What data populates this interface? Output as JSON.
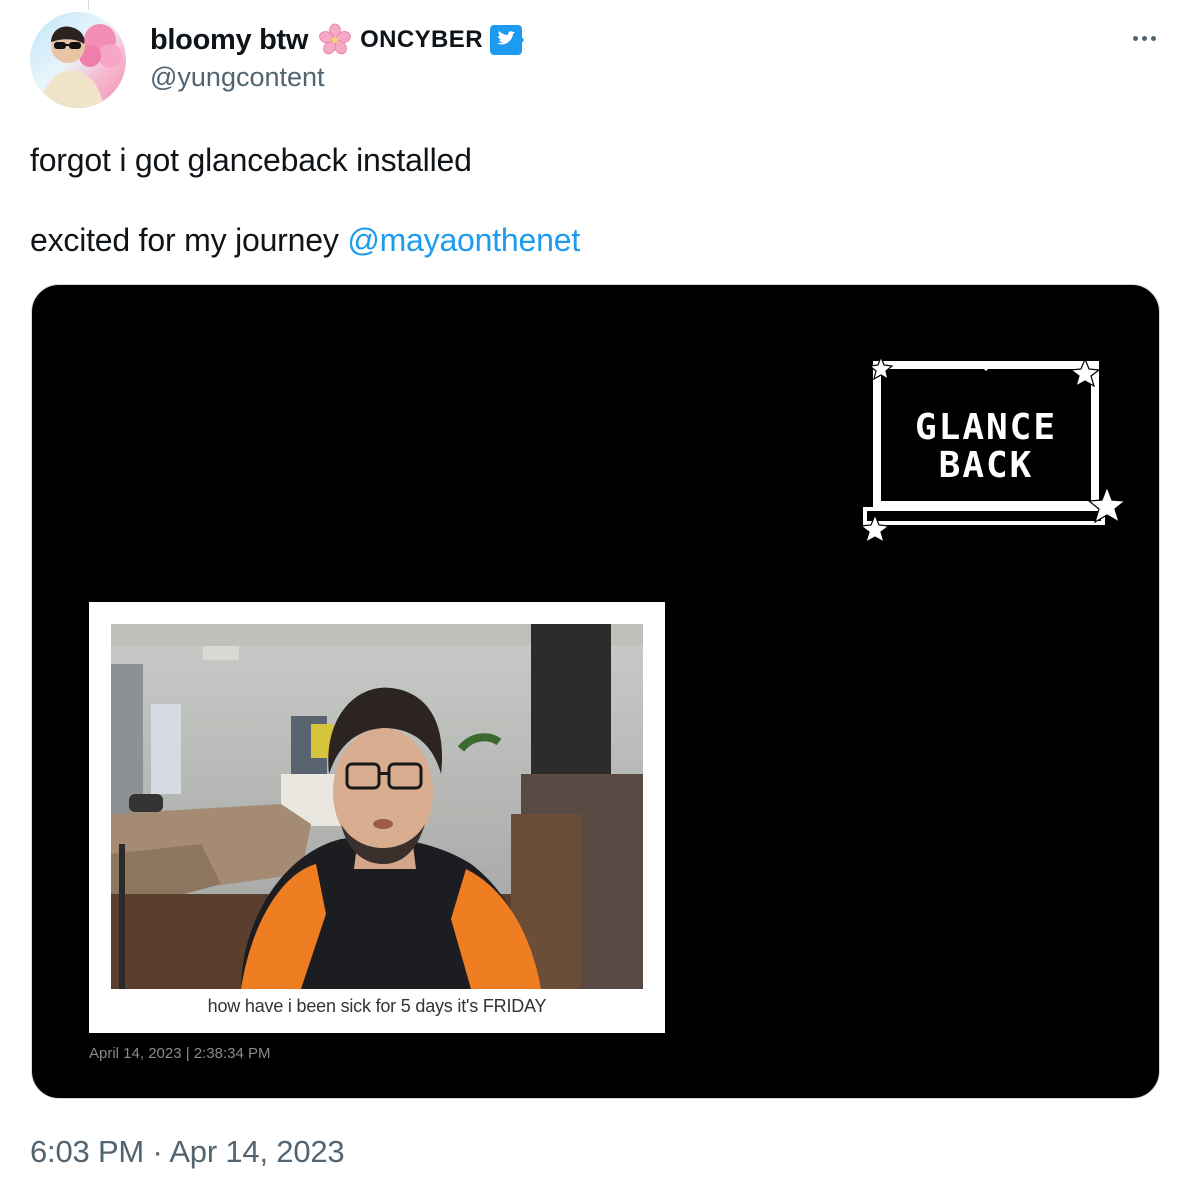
{
  "author": {
    "display_name": "bloomy btw",
    "affiliate": "ONCYBER",
    "handle": "@yungcontent",
    "emoji_icon": "cherry-blossom-icon",
    "verified_color": "#1d9bf0"
  },
  "tweet": {
    "line1": "forgot i got glanceback installed",
    "line2_prefix": "excited for my journey ",
    "mention": "@mayaonthenet",
    "mention_color": "#1d9bf0"
  },
  "media": {
    "logo_lines": [
      "GLANCE",
      "BACK"
    ],
    "caption": "how have i been sick for 5 days it's FRIDAY",
    "timestamp": "April 14, 2023 | 2:38:34 PM"
  },
  "meta": {
    "time": "6:03 PM",
    "separator": " · ",
    "date": "Apr 14, 2023"
  }
}
